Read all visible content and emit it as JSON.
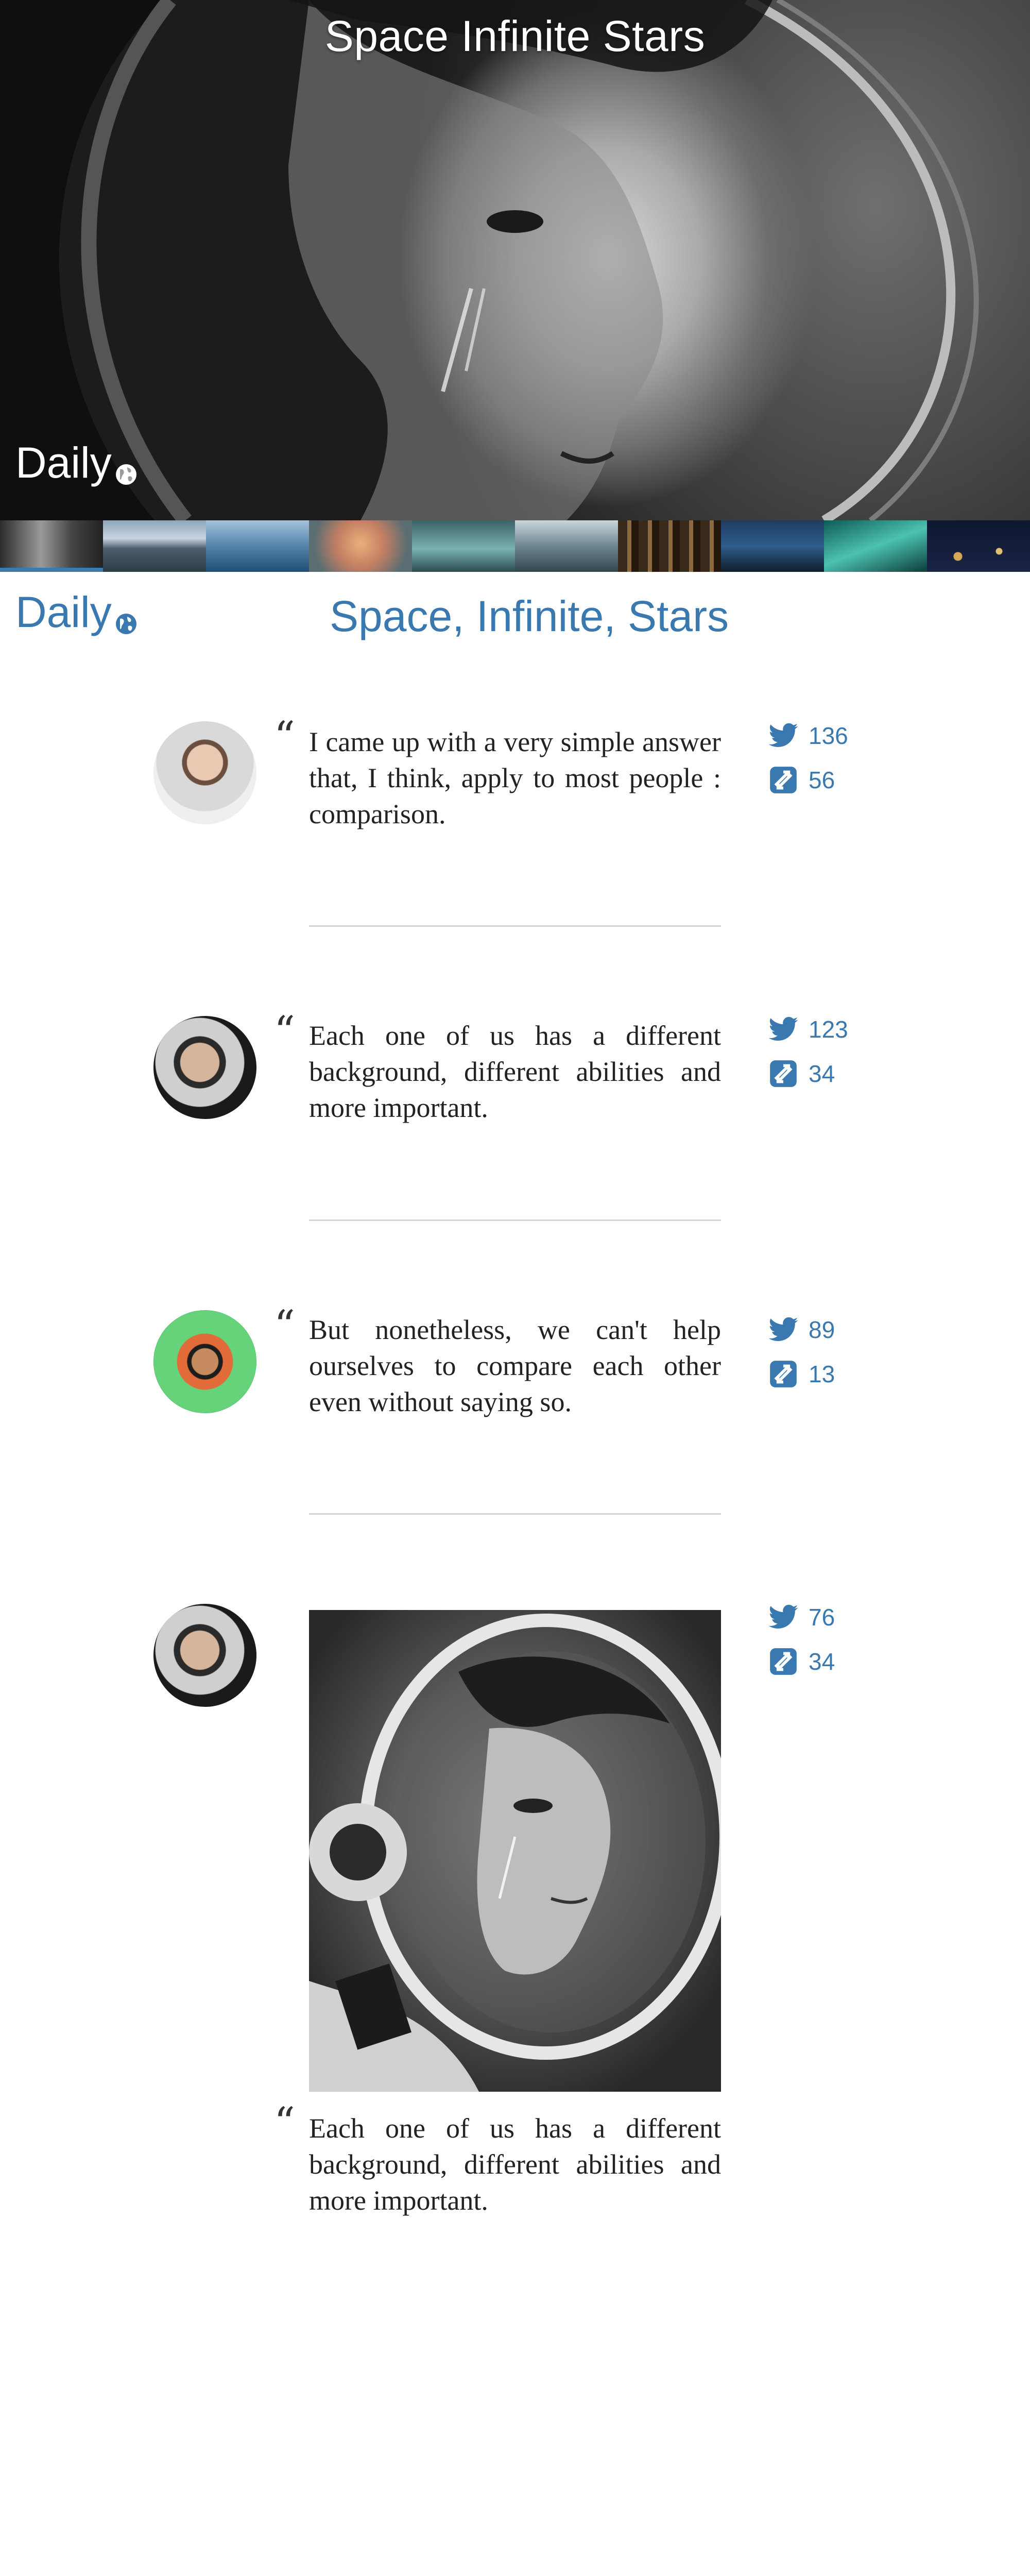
{
  "hero": {
    "title": "Space Infinite Stars",
    "brand": "Daily"
  },
  "header": {
    "brand": "Daily",
    "title": "Space, Infinite, Stars"
  },
  "icons": {
    "twitter": "twitter-icon",
    "retweet": "retweet-icon",
    "globe": "globe-icon"
  },
  "colors": {
    "accent": "#3a78b0",
    "divider": "#d5d5d5"
  },
  "thumbnails": [
    {
      "name": "astronaut"
    },
    {
      "name": "mountain-lake"
    },
    {
      "name": "ocean"
    },
    {
      "name": "sunset-blur"
    },
    {
      "name": "teal-coast"
    },
    {
      "name": "rocky-shore"
    },
    {
      "name": "city-night"
    },
    {
      "name": "harbor"
    },
    {
      "name": "wave"
    },
    {
      "name": "bokeh-lights"
    }
  ],
  "posts": [
    {
      "quote": "I came up with a very simple answer that, I think, apply to most people : comparison.",
      "tweets": "136",
      "retweets": "56"
    },
    {
      "quote": "Each one of us has a different background, different abilities and more important.",
      "tweets": "123",
      "retweets": "34"
    },
    {
      "quote": "But nonetheless, we can't help ourselves to compare each other even without saying so.",
      "tweets": "89",
      "retweets": "13"
    },
    {
      "quote": "Each one of us has a different background, different abilities and more important.",
      "tweets": "76",
      "retweets": "34"
    }
  ]
}
